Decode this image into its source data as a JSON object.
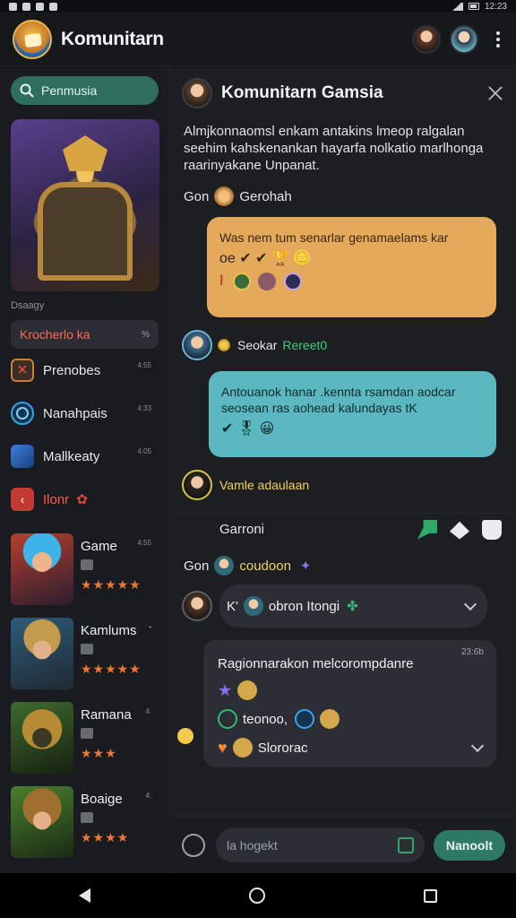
{
  "status_bar": {
    "time": "12:23"
  },
  "app": {
    "title": "Komunitarn"
  },
  "sidebar": {
    "search_placeholder": "Penmusia",
    "hero_caption": "Dsaagy",
    "section_label": "Krocherlo ka",
    "section_tag": "%",
    "items": [
      {
        "label": "Prenobes",
        "meta": "4:55",
        "icon": "crossed-swords-icon"
      },
      {
        "label": "Nanahpais",
        "meta": "4:33",
        "icon": "ring-icon"
      },
      {
        "label": "Mallkeaty",
        "meta": "4:05",
        "icon": "moon-icon"
      },
      {
        "label": "Ilonr",
        "meta": "",
        "icon": "arrow-icon"
      }
    ],
    "games": [
      {
        "name": "Game",
        "meta": "4:55",
        "stars": "★★★★★"
      },
      {
        "name": "Kamlums",
        "meta": "•",
        "stars": "★★★★★"
      },
      {
        "name": "Ramana",
        "meta": "4:",
        "stars": "★★★"
      },
      {
        "name": "Boaige",
        "meta": "4:",
        "stars": "★★★★"
      }
    ]
  },
  "chat": {
    "title": "Komunitarn Gamsia",
    "intro": "Almjkonnaomsl enkam antakins lmeop ralgalan seehim kahskenankan hayarfa nolkatio marlhonga raarinyakane Unpanat.",
    "msg1": {
      "sender_prefix": "Gon",
      "sender": "Gerohah",
      "text": "Was nem tum senarlar genamaelams kar",
      "emoji_text": "oe ✔ ✔ 🏆 🪙"
    },
    "msg2": {
      "sender": "Seokar",
      "status": "Rereet0",
      "text": "Antouanok hanar .kennta rsamdan aodcar seosean ras aohead kalundayas tK",
      "emoji_text": "✔ 🎖 😀"
    },
    "user_row": {
      "label": "Vamle adaulaan"
    },
    "tool_row": {
      "label": "Garroni"
    },
    "gon_row": {
      "prefix": "Gon",
      "label": "coudoon"
    },
    "accordion": {
      "prefix": "K'",
      "label": "obron Itongi"
    },
    "card": {
      "time": "23:6b",
      "title": "Ragionnarakon melcorompdanre",
      "line1": "teonoo,",
      "line2": "Slororac"
    }
  },
  "composer": {
    "placeholder": "la hogekt",
    "send_label": "Nanoolt"
  },
  "colors": {
    "accent": "#2f7a64",
    "bubble_gold": "#e4a95a",
    "bubble_teal": "#5bb7c0",
    "star": "#f0772d"
  }
}
